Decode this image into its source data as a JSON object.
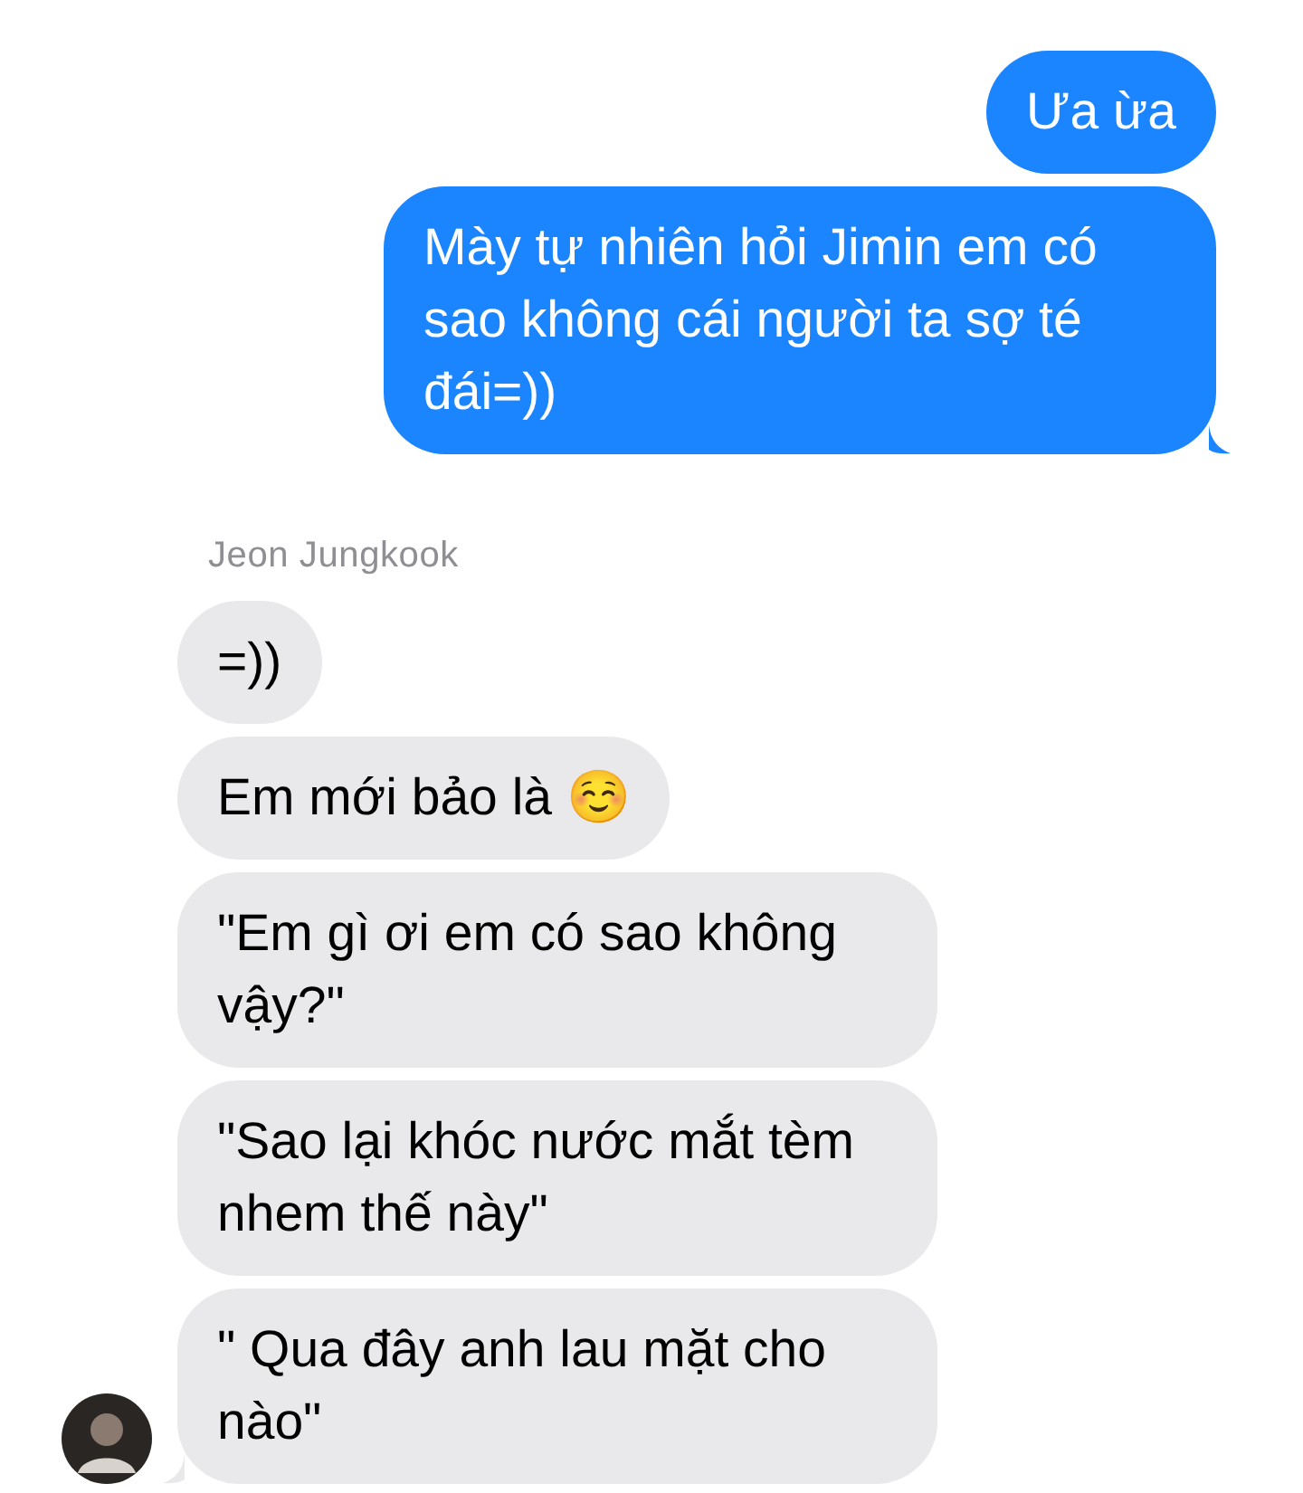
{
  "messages": [
    {
      "kind": "sent",
      "text": "Ưa ừa",
      "tail": false
    },
    {
      "kind": "sent",
      "text": "Mày tự nhiên hỏi Jimin em có sao không cái người ta sợ té đái=))",
      "tail": true
    },
    {
      "kind": "sender",
      "text": "Jeon Jungkook"
    },
    {
      "kind": "received",
      "text": "=))",
      "tail": false,
      "avatar": false
    },
    {
      "kind": "received",
      "text": "Em mới bảo là ☺️",
      "tail": false,
      "avatar": false
    },
    {
      "kind": "received",
      "text": "\"Em gì ơi em có sao không vậy?\"",
      "tail": false,
      "avatar": false
    },
    {
      "kind": "received",
      "text": "\"Sao lại khóc nước mắt tèm nhem thế này\"",
      "tail": false,
      "avatar": false
    },
    {
      "kind": "received",
      "text": "\" Qua đây anh lau mặt cho nào\"",
      "tail": true,
      "avatar": true
    }
  ]
}
